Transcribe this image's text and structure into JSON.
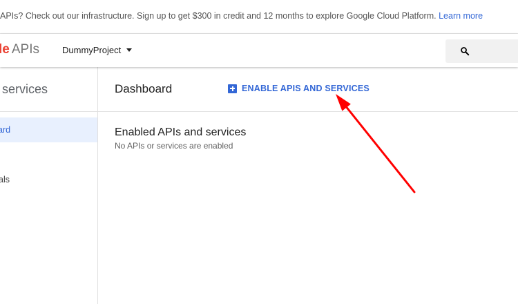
{
  "promo": {
    "text": "APIs? Check out our infrastructure. Sign up to get $300 in credit and 12 months to explore Google Cloud Platform.",
    "link": "Learn more"
  },
  "header": {
    "logo_partial": "le",
    "logo_apis": "APIs",
    "project_name": "DummyProject",
    "icons": {
      "search": "search-icon",
      "project_dropdown": "caret-down-icon"
    }
  },
  "sidebar": {
    "title": "& services",
    "items": [
      {
        "label": "ard",
        "active": true
      },
      {
        "label": "als",
        "active": false
      }
    ]
  },
  "main": {
    "title": "Dashboard",
    "enable_button": "ENABLE APIS AND SERVICES",
    "section_title": "Enabled APIs and services",
    "section_subtitle": "No APIs or services are enabled"
  },
  "colors": {
    "accent": "#3367d6",
    "active_bg": "#e8f0fe",
    "annotation": "#ff0000"
  }
}
